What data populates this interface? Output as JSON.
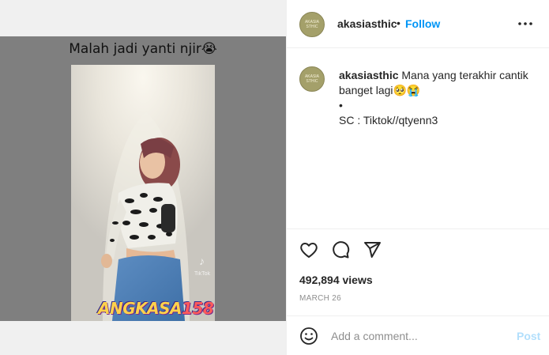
{
  "media": {
    "overlay_caption": "Malah jadi yanti njir😭",
    "tiktok_watermark": "TikTok",
    "brand_logo_text": "ANGKASA",
    "brand_logo_number": "158"
  },
  "post": {
    "account": {
      "username": "akasiasthic",
      "avatar_text": "AKASIA STHIC"
    },
    "follow_label": "Follow",
    "separator": "•",
    "comment": {
      "username": "akasiasthic",
      "text_line1": "Mana yang terakhir cantik banget lagi🥺😭",
      "bullet": "•",
      "credit": "SC : Tiktok//qtyenn3"
    },
    "views": "492,894 views",
    "date": "MARCH 26",
    "add_comment_placeholder": "Add a comment...",
    "post_label": "Post",
    "colors": {
      "follow": "#0095f6",
      "post_disabled": "#b2dffc",
      "avatar": "#a4a06a"
    },
    "icons": [
      "heart-icon",
      "comment-icon",
      "share-icon",
      "emoji-icon",
      "more-icon",
      "muted-speaker-icon"
    ]
  }
}
